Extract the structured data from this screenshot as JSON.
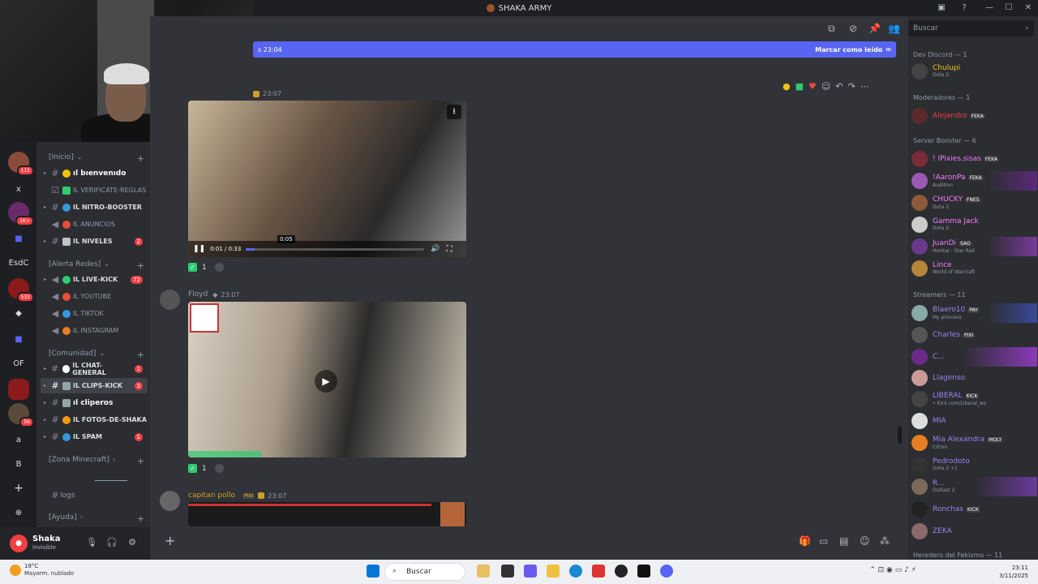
{
  "window": {
    "title": "SHAKA ARMY"
  },
  "sidebar": {
    "categories": {
      "inicio": "[Inicio]",
      "alerta": "[Alerta Redes]",
      "comunidad": "[Comunidad]",
      "minecraft": "[Zona Minecraft]",
      "ayuda": "[Ayuda]"
    },
    "channels": [
      {
        "name": "ıl bıenvenıdo",
        "badge": ""
      },
      {
        "name": "ıl verificate-reglas",
        "badge": ""
      },
      {
        "name": "ıl nitro-booster",
        "badge": ""
      },
      {
        "name": "ıl anuncios",
        "badge": ""
      },
      {
        "name": "ıl niveles",
        "badge": "2"
      },
      {
        "name": "ıl live-kick",
        "badge": "72"
      },
      {
        "name": "ıl youtube",
        "badge": ""
      },
      {
        "name": "ıl tiktok",
        "badge": ""
      },
      {
        "name": "ıl instagram",
        "badge": ""
      },
      {
        "name": "ıl chat-general",
        "badge": "1"
      },
      {
        "name": "ıl clips-kick",
        "badge": "3"
      },
      {
        "name": "ıl cliperos",
        "badge": ""
      },
      {
        "name": "ıl fotos-de-shaka",
        "badge": ""
      },
      {
        "name": "ıl spam",
        "badge": "1"
      },
      {
        "name": "logs",
        "badge": ""
      }
    ]
  },
  "servers": [
    "115",
    "x",
    "1K+",
    "",
    "EsdC",
    "533",
    "",
    "",
    "OF",
    "",
    "56",
    "a",
    "B"
  ],
  "user": {
    "name": "Shaka",
    "status": "Invisible"
  },
  "chat": {
    "unread_text": "s 23:04",
    "mark_read": "Marcar como leído",
    "msg1": {
      "time": "23:07",
      "current": "0:01 / 0:33",
      "tooltip": "0:05",
      "reaction_count": "1"
    },
    "msg2": {
      "author": "Floyd",
      "time": "23:07",
      "reaction_count": "1"
    },
    "msg3": {
      "author": "capitan pollo",
      "tag": "PIXI",
      "time": "23:07"
    }
  },
  "members": {
    "search_placeholder": "Buscar",
    "groups": [
      {
        "label": "Dev Discord — 1",
        "items": [
          {
            "name": "Chulupi",
            "sub": "Dota 2",
            "color": "#f1c40f",
            "tag": ""
          }
        ]
      },
      {
        "label": "Moderadores — 1",
        "items": [
          {
            "name": "Alejandro",
            "sub": "",
            "color": "#f23f43",
            "tag": "FEKA"
          }
        ]
      },
      {
        "label": "Server Booster — 6",
        "items": [
          {
            "name": "! IPixies.sisas",
            "sub": "",
            "color": "#f47fff",
            "tag": "FEKA"
          },
          {
            "name": "!AaronPa",
            "sub": "Audition",
            "color": "#f47fff",
            "tag": "FEKA"
          },
          {
            "name": "CHUCKY",
            "sub": "Dota 2",
            "color": "#f47fff",
            "tag": "FNES"
          },
          {
            "name": "Gamma Jack",
            "sub": "Dota 2",
            "color": "#f47fff",
            "tag": ""
          },
          {
            "name": "JuanDi",
            "sub": "Honkai : Star Rail",
            "color": "#f47fff",
            "tag": "SAO"
          },
          {
            "name": "Lince",
            "sub": "World of Warcraft",
            "color": "#f47fff",
            "tag": ""
          }
        ]
      },
      {
        "label": "Streamers — 11",
        "items": [
          {
            "name": "Blaero10",
            "sub": "My princess",
            "color": "#9b84ee",
            "tag": "PAY"
          },
          {
            "name": "Charles",
            "sub": "",
            "color": "#9b84ee",
            "tag": "PIXI"
          },
          {
            "name": "C...",
            "sub": "",
            "color": "#9b84ee",
            "tag": ""
          },
          {
            "name": "Llagenso",
            "sub": "",
            "color": "#9b84ee",
            "tag": ""
          },
          {
            "name": "LIBERAL",
            "sub": "• Kick.com/Liberal_ws",
            "color": "#9b84ee",
            "tag": "KICK"
          },
          {
            "name": "MIA",
            "sub": "",
            "color": "#9b84ee",
            "tag": ""
          },
          {
            "name": "Mia Alexandra",
            "sub": "Citron",
            "color": "#9b84ee",
            "tag": "MOLY"
          },
          {
            "name": "Pedrodoto",
            "sub": "Dota 2 +1",
            "color": "#9b84ee",
            "tag": ""
          },
          {
            "name": "R...",
            "sub": "Outlast 2",
            "color": "#9b84ee",
            "tag": ""
          },
          {
            "name": "Ronchas",
            "sub": "",
            "color": "#9b84ee",
            "tag": "KICK"
          },
          {
            "name": "ZEKA",
            "sub": "",
            "color": "#9b84ee",
            "tag": ""
          }
        ]
      },
      {
        "label": "Heredero del Fekismo — 11",
        "items": []
      }
    ]
  },
  "taskbar": {
    "weather_temp": "18°C",
    "weather_desc": "Mayorm. nublado",
    "search": "Buscar",
    "time": "23:11",
    "date": "3/11/2025"
  }
}
